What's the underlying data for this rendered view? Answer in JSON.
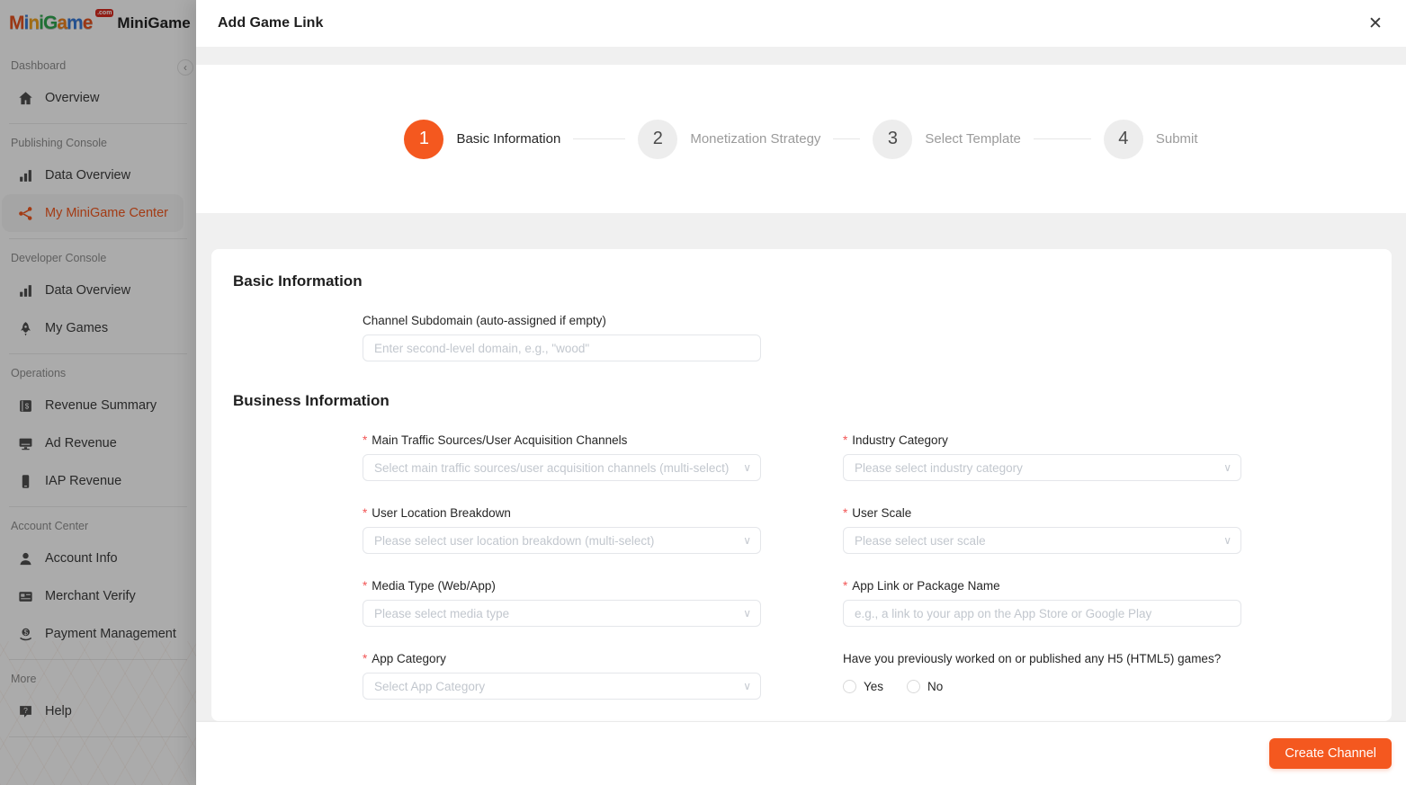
{
  "colors": {
    "accent": "#f4581f",
    "body_gray": "#f0f0f0"
  },
  "icons": {
    "close": "✕",
    "collapse": "‹",
    "chevron": "∨",
    "required_marker": "*"
  },
  "sidebar": {
    "logo": {
      "letters": [
        "M",
        "i",
        "n",
        "i",
        "G",
        "a",
        "m",
        "e"
      ],
      "badge": ".com",
      "app_name": "MiniGame"
    },
    "sections": [
      {
        "label": "Dashboard",
        "items": [
          {
            "icon": "home-icon",
            "label": "Overview"
          }
        ]
      },
      {
        "label": "Publishing Console",
        "items": [
          {
            "icon": "bar-chart-icon",
            "label": "Data Overview"
          },
          {
            "icon": "share-icon",
            "label": "My MiniGame Center"
          }
        ]
      },
      {
        "label": "Developer Console",
        "items": [
          {
            "icon": "bar-chart-icon",
            "label": "Data Overview"
          },
          {
            "icon": "rocket-icon",
            "label": "My Games"
          }
        ]
      },
      {
        "label": "Operations",
        "items": [
          {
            "icon": "ledger-icon",
            "label": "Revenue Summary"
          },
          {
            "icon": "display-icon",
            "label": "Ad Revenue"
          },
          {
            "icon": "mobile-icon",
            "label": "IAP Revenue"
          }
        ]
      },
      {
        "label": "Account Center",
        "items": [
          {
            "icon": "user-icon",
            "label": "Account Info"
          },
          {
            "icon": "id-card-icon",
            "label": "Merchant Verify"
          },
          {
            "icon": "payment-icon",
            "label": "Payment Management"
          }
        ]
      },
      {
        "label": "More",
        "items": [
          {
            "icon": "help-icon",
            "label": "Help"
          }
        ]
      }
    ]
  },
  "modal": {
    "title": "Add Game Link",
    "steps": [
      {
        "number": "1",
        "label": "Basic Information"
      },
      {
        "number": "2",
        "label": "Monetization Strategy"
      },
      {
        "number": "3",
        "label": "Select Template"
      },
      {
        "number": "4",
        "label": "Submit"
      }
    ],
    "form": {
      "basic_title": "Basic Information",
      "subdomain": {
        "label": "Channel Subdomain (auto-assigned if empty)",
        "placeholder": "Enter second-level domain, e.g., \"wood\""
      },
      "business_title": "Business Information",
      "fields": [
        {
          "required": "*",
          "label": "Main Traffic Sources/User Acquisition Channels",
          "type": "select",
          "placeholder": "Select main traffic sources/user acquisition channels (multi-select)"
        },
        {
          "required": "*",
          "label": "Industry Category",
          "type": "select",
          "placeholder": "Please select industry category"
        },
        {
          "required": "*",
          "label": "User Location Breakdown",
          "type": "select",
          "placeholder": "Please select user location breakdown (multi-select)"
        },
        {
          "required": "*",
          "label": "User Scale",
          "type": "select",
          "placeholder": "Please select user scale"
        },
        {
          "required": "*",
          "label": "Media Type (Web/App)",
          "type": "select",
          "placeholder": "Please select media type"
        },
        {
          "required": "*",
          "label": "App Link or Package Name",
          "type": "input",
          "placeholder": "e.g., a link to your app on the App Store or Google Play"
        },
        {
          "required": "*",
          "label": "App Category",
          "type": "select",
          "placeholder": "Select App Category"
        },
        {
          "required": "",
          "label": "Have you previously worked on or published any H5 (HTML5) games?",
          "type": "radio",
          "options": [
            "Yes",
            "No"
          ]
        }
      ]
    },
    "footer": {
      "create_label": "Create Channel"
    }
  }
}
